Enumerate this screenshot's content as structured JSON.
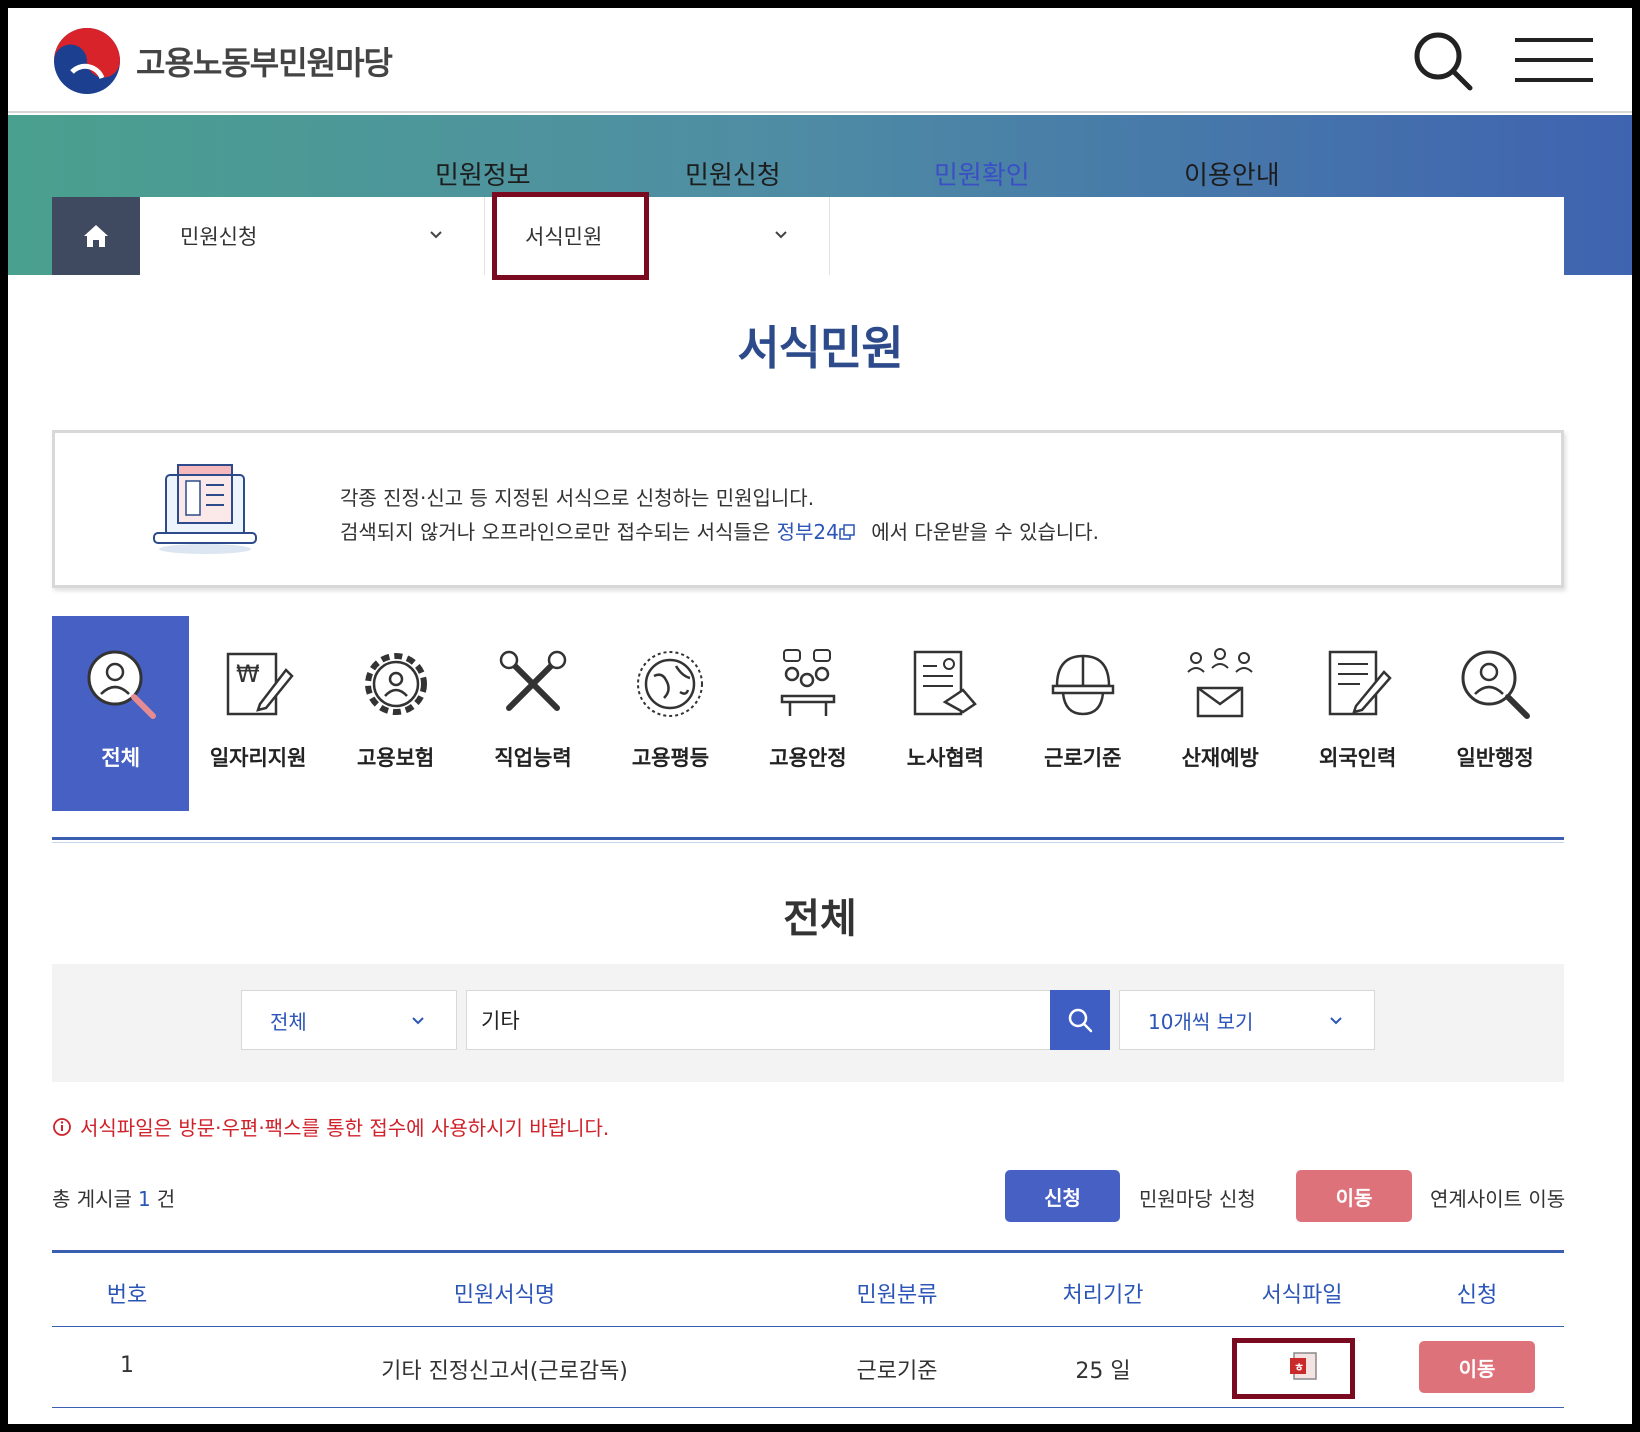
{
  "header": {
    "logo_text": "고용노동부민원마당"
  },
  "gnb": [
    {
      "label": "민원정보",
      "active": false
    },
    {
      "label": "민원신청",
      "active": false
    },
    {
      "label": "민원확인",
      "active": true
    },
    {
      "label": "이용안내",
      "active": false
    }
  ],
  "location": {
    "depth1": "민원신청",
    "depth2": "서식민원"
  },
  "page_title": "서식민원",
  "info": {
    "line1": "각종 진정·신고 등 지정된 서식으로 신청하는 민원입니다.",
    "line2_pre": "검색되지 않거나 오프라인으로만 접수되는 서식들은",
    "line2_link": "정부24",
    "line2_post": "에서 다운받을 수 있습니다."
  },
  "categories": [
    {
      "label": "전체",
      "icon": "person-magnifier-icon",
      "active": true
    },
    {
      "label": "일자리지원",
      "icon": "won-document-pen-icon",
      "active": false
    },
    {
      "label": "고용보험",
      "icon": "gear-person-icon",
      "active": false
    },
    {
      "label": "직업능력",
      "icon": "tools-icon",
      "active": false
    },
    {
      "label": "고용평등",
      "icon": "globe-icon",
      "active": false
    },
    {
      "label": "고용안정",
      "icon": "meeting-people-icon",
      "active": false
    },
    {
      "label": "노사협력",
      "icon": "document-handshake-icon",
      "active": false
    },
    {
      "label": "근로기준",
      "icon": "safety-helmet-icon",
      "active": false
    },
    {
      "label": "산재예방",
      "icon": "people-mail-icon",
      "active": false
    },
    {
      "label": "외국인력",
      "icon": "document-pen-icon",
      "active": false
    },
    {
      "label": "일반행정",
      "icon": "person-magnifier-icon",
      "active": false
    }
  ],
  "section_title": "전체",
  "search": {
    "category_value": "전체",
    "keyword": "기타",
    "page_size": "10개씩 보기"
  },
  "notice": "서식파일은 방문·우편·팩스를 통한 접수에 사용하시기 바랍니다.",
  "total": {
    "prefix": "총 게시글",
    "count": "1",
    "suffix": "건"
  },
  "legend": {
    "apply_btn": "신청",
    "apply_text": "민원마당 신청",
    "move_btn": "이동",
    "move_text": "연계사이트 이동"
  },
  "table": {
    "headers": [
      "번호",
      "민원서식명",
      "민원분류",
      "처리기간",
      "서식파일",
      "신청"
    ],
    "rows": [
      {
        "no": "1",
        "name": "기타 진정신고서(근로감독)",
        "category": "근로기준",
        "period": "25 일",
        "file_icon": "hwp-file-icon",
        "action": "이동"
      }
    ]
  },
  "colors": {
    "primary": "#4760c3",
    "accent_red": "#de727b",
    "title_blue": "#2d4a8a",
    "highlight_box": "#7a0a1f",
    "notice_red": "#d0222b"
  }
}
